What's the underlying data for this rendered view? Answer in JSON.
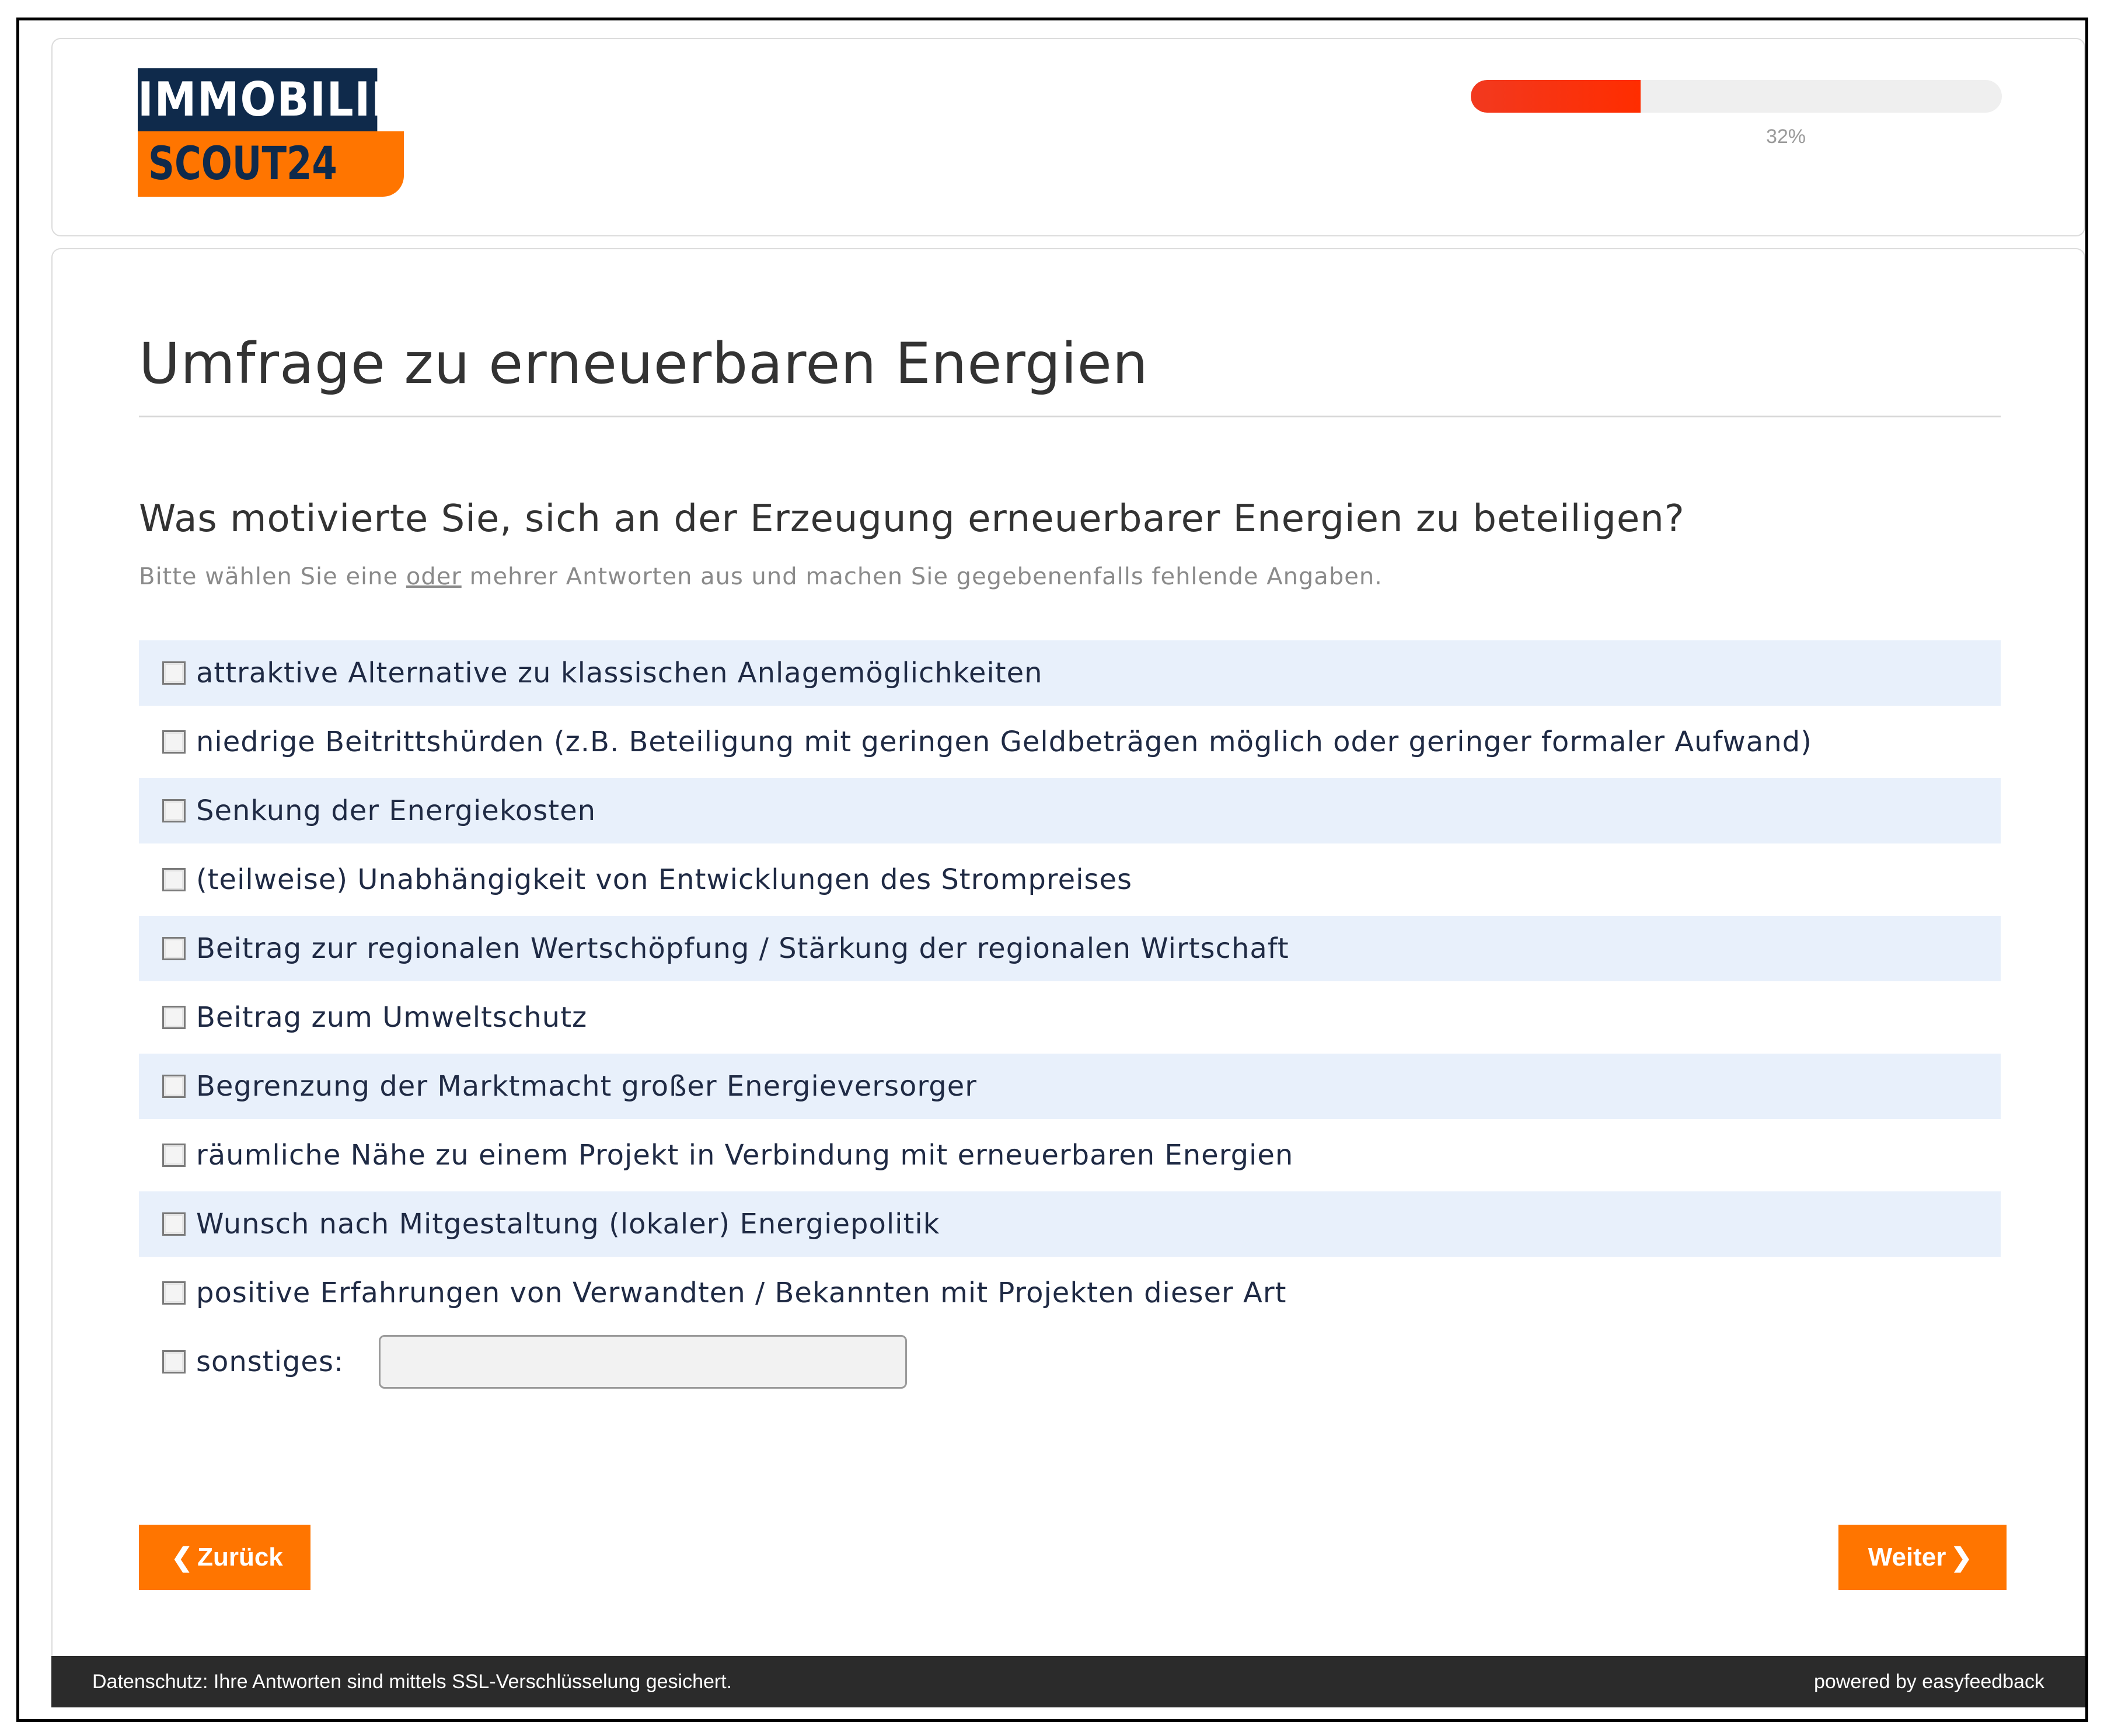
{
  "logo": {
    "line1": "IMMOBILIEN",
    "line2": "SCOUT24",
    "colors": {
      "navy": "#0f2a4b",
      "orange": "#ff7500"
    }
  },
  "progress": {
    "value": 0.32,
    "label": "32%"
  },
  "survey": {
    "title": "Umfrage zu erneuerbaren Energien",
    "question": "Was motivierte Sie, sich an der Erzeugung erneuerbarer Energien zu beteiligen?",
    "hint_before": "Bitte wählen Sie eine ",
    "hint_underlined": "oder",
    "hint_after": " mehrer Antworten aus und machen Sie gegebenenfalls fehlende Angaben.",
    "options": [
      "attraktive Alternative zu klassischen Anlagemöglichkeiten",
      "niedrige Beitrittshürden (z.B. Beteiligung mit geringen Geldbeträgen möglich oder geringer formaler Aufwand)",
      "Senkung der Energiekosten",
      "(teilweise) Unabhängigkeit von Entwicklungen des Strompreises",
      "Beitrag zur regionalen Wertschöpfung / Stärkung der regionalen Wirtschaft",
      "Beitrag zum Umweltschutz",
      "Begrenzung der Marktmacht großer Energieversorger",
      "räumliche Nähe zu einem Projekt in Verbindung mit erneuerbaren Energien",
      "Wunsch nach Mitgestaltung (lokaler) Energiepolitik",
      "positive Erfahrungen von Verwandten / Bekannten mit Projekten dieser Art"
    ],
    "other_label": "sonstiges:",
    "other_value": ""
  },
  "buttons": {
    "back": "Zurück",
    "next": "Weiter",
    "back_icon": "chevron-left-icon",
    "next_icon": "chevron-right-icon"
  },
  "footer": {
    "privacy": "Datenschutz: Ihre Antworten sind mittels SSL-Verschlüsselung gesichert.",
    "powered": "powered by easyfeedback"
  }
}
